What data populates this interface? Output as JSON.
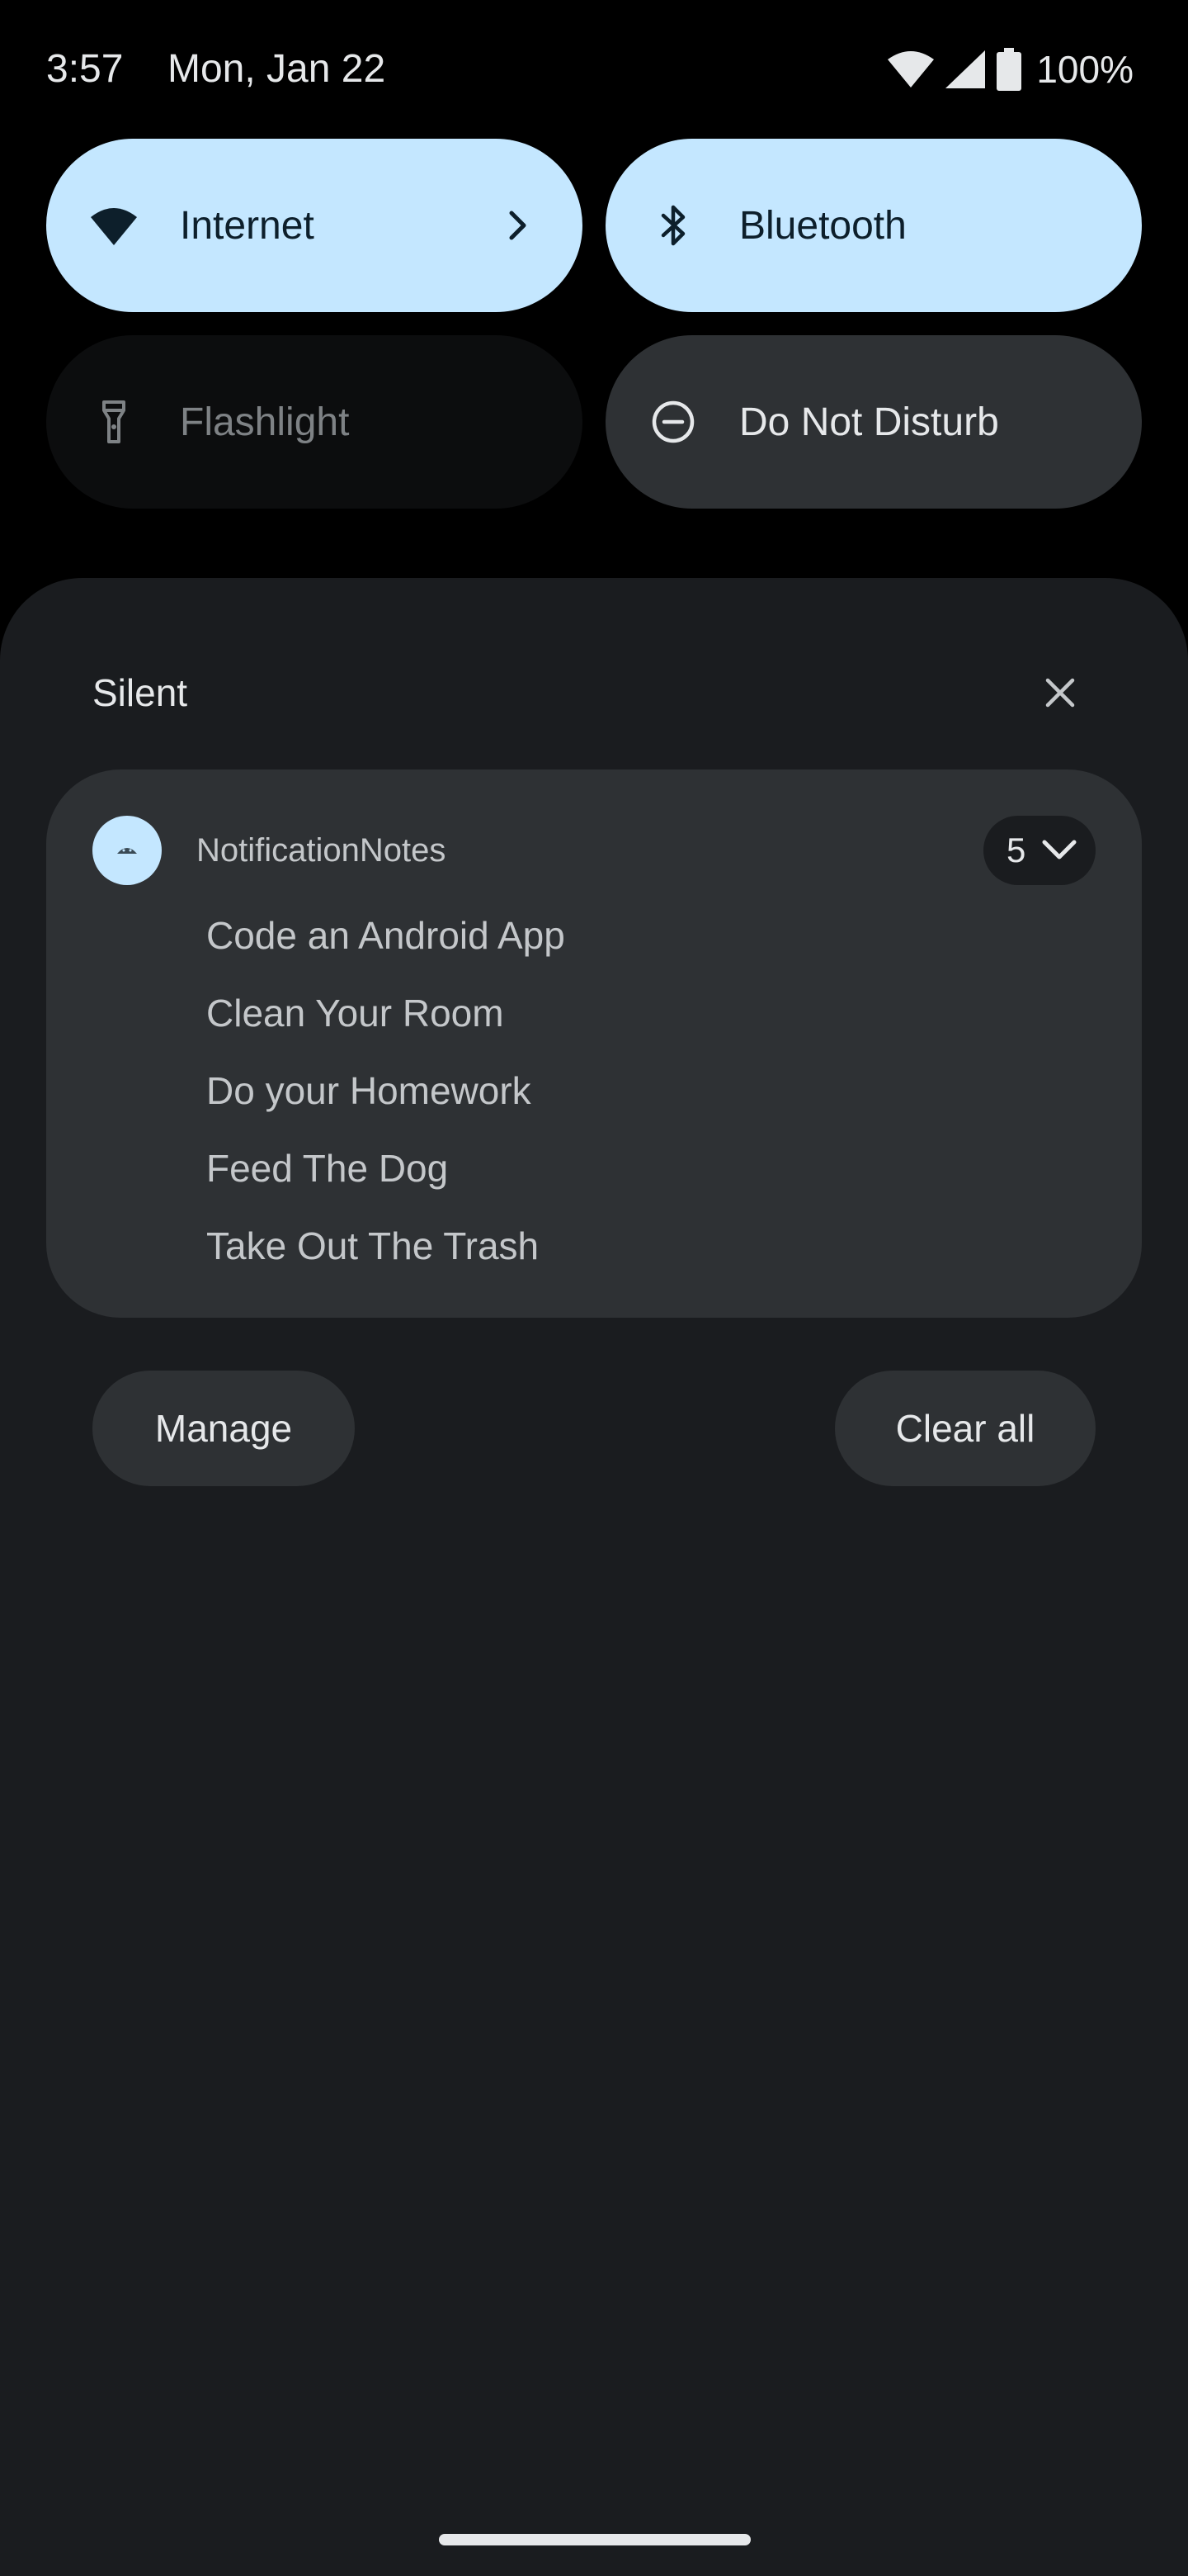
{
  "status_bar": {
    "time": "3:57",
    "date": "Mon, Jan 22",
    "battery_text": "100%",
    "icons": [
      "wifi-icon",
      "signal-icon",
      "battery-icon"
    ]
  },
  "quick_settings": {
    "tiles": [
      {
        "label": "Internet",
        "icon": "wifi-icon",
        "state": "on",
        "has_chevron": true
      },
      {
        "label": "Bluetooth",
        "icon": "bluetooth-icon",
        "state": "on"
      },
      {
        "label": "Flashlight",
        "icon": "flashlight-icon",
        "state": "unavailable"
      },
      {
        "label": "Do Not Disturb",
        "icon": "do-not-disturb-icon",
        "state": "off"
      }
    ]
  },
  "notifications": {
    "section_title": "Silent",
    "group": {
      "app_name": "NotificationNotes",
      "count": "5",
      "items": [
        "Code an Android App",
        "Clean Your Room",
        "Do your Homework",
        "Feed The Dog",
        "Take Out The Trash"
      ]
    },
    "manage_label": "Manage",
    "clear_all_label": "Clear all"
  },
  "colors": {
    "tile_on": "#c4e7ff",
    "tile_off": "#2e3134",
    "shade_background": "#1a1c1f",
    "screen_background": "#000000"
  }
}
